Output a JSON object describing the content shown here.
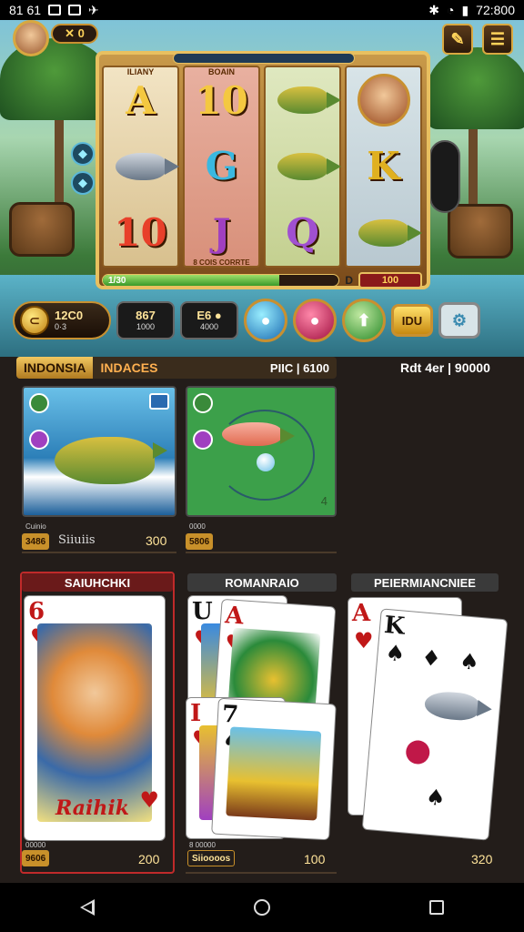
{
  "status_bar": {
    "left_text": "81 61",
    "time": "72:800"
  },
  "hud": {
    "coin_pill": "✕ 0",
    "edit_icon": "✎",
    "menu_icon": "☰"
  },
  "reels": {
    "col1_head": "ILIANY",
    "col2_head": "BOAIN",
    "reel1": [
      "A",
      "fish-grey",
      "10"
    ],
    "reel2": [
      "10",
      "G",
      "J"
    ],
    "reel3": [
      "fish-gold",
      "fish-green",
      "Q"
    ],
    "reel4": [
      "portrait",
      "K",
      "fish-green"
    ],
    "col2_foot": "8 COIS CORRTE"
  },
  "progress": {
    "label": "1/30",
    "value": 0.75,
    "mid": "D",
    "bet": "100"
  },
  "controls": {
    "balance": "12C0",
    "balance_sub": "0·3",
    "stat1": "867",
    "stat1_sub": "1000",
    "stat2": "E6 ●",
    "stat2_sub": "4000",
    "btn_idu": "IDU"
  },
  "lobby": {
    "tab_active": "INDONSIA",
    "tab_other": "INDACES",
    "price_label": "PIIC | 6100",
    "balance": "Rdt 4er | 90000",
    "tiles": [
      {
        "meta": "Cuinio",
        "tag": "3486",
        "sub": "Siiuiis",
        "price": "300"
      },
      {
        "meta": "0000",
        "tag": "5806",
        "corner": "4"
      }
    ],
    "decks": [
      {
        "title": "SAIUHCHKI",
        "name_on_card": "Raihik",
        "meta": "00000",
        "tag": "9606",
        "price": "200"
      },
      {
        "title": "ROMANRAIO",
        "meta": "8 00000",
        "tag": "Siioooos",
        "price": "100"
      },
      {
        "title": "PEIERMIANCNIEE",
        "price": "320"
      }
    ]
  },
  "colors": {
    "accent_gold": "#e8c060",
    "panel": "#231d1a",
    "red": "#c02a2a"
  }
}
